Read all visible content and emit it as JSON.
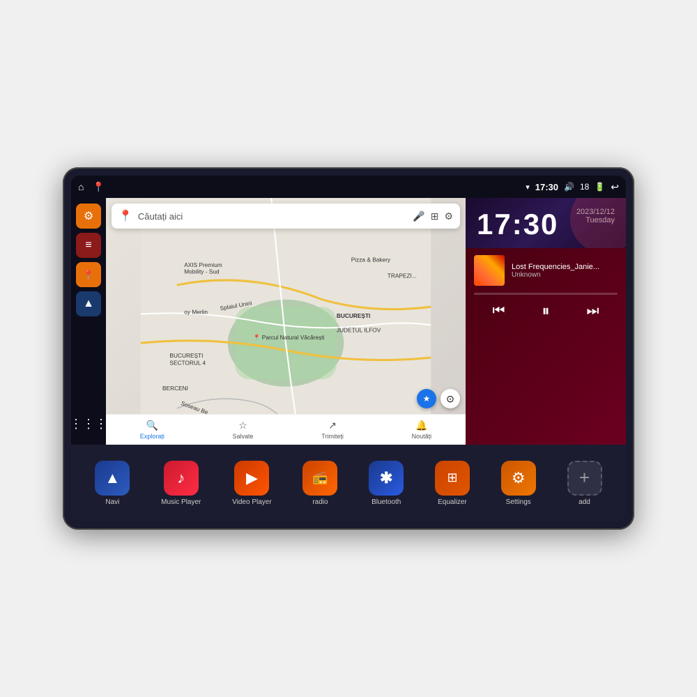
{
  "device": {
    "status_bar": {
      "left_icons": [
        "home",
        "map-pin"
      ],
      "time": "17:30",
      "signal": "▾",
      "volume": "🔊",
      "battery_level": "18",
      "battery": "🔋",
      "back": "↩"
    },
    "clock": {
      "time": "17:30",
      "date": "2023/12/12",
      "day": "Tuesday"
    },
    "music": {
      "title": "Lost Frequencies_Janie...",
      "artist": "Unknown"
    },
    "map": {
      "search_placeholder": "Căutați aici",
      "bottom_items": [
        {
          "label": "Explorați",
          "icon": "🔍"
        },
        {
          "label": "Salvate",
          "icon": "☆"
        },
        {
          "label": "Trimiteți",
          "icon": "↗"
        },
        {
          "label": "Noutăți",
          "icon": "🔔"
        }
      ]
    },
    "sidebar": {
      "buttons": [
        "⚙",
        "≡",
        "📍",
        "▲"
      ]
    },
    "apps": [
      {
        "label": "Navi",
        "icon": "▲",
        "color": "navi"
      },
      {
        "label": "Music Player",
        "icon": "♫",
        "color": "music"
      },
      {
        "label": "Video Player",
        "icon": "▶",
        "color": "video"
      },
      {
        "label": "radio",
        "icon": "📻",
        "color": "radio"
      },
      {
        "label": "Bluetooth",
        "icon": "⚡",
        "color": "bt"
      },
      {
        "label": "Equalizer",
        "icon": "≡",
        "color": "eq"
      },
      {
        "label": "Settings",
        "icon": "⚙",
        "color": "settings"
      },
      {
        "label": "add",
        "icon": "+",
        "color": "add"
      }
    ],
    "controls": {
      "prev": "⏮",
      "pause": "⏸",
      "next": "⏭"
    }
  }
}
